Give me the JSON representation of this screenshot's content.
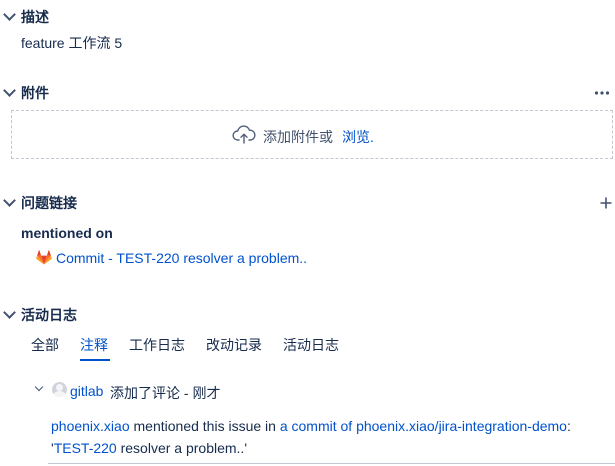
{
  "description": {
    "title": "描述",
    "body": "feature 工作流 5"
  },
  "attachments": {
    "title": "附件",
    "more_icon": "ellipsis-icon",
    "drop_text": "添加附件或",
    "browse_link": "浏览."
  },
  "issue_links": {
    "title": "问题链接",
    "add_icon": "plus-icon",
    "relation": "mentioned on",
    "items": [
      {
        "icon": "gitlab-icon",
        "text": "Commit - TEST-220 resolver a problem.."
      }
    ]
  },
  "activity": {
    "title": "活动日志",
    "tabs": [
      {
        "label": "全部",
        "active": false
      },
      {
        "label": "注释",
        "active": true
      },
      {
        "label": "工作日志",
        "active": false
      },
      {
        "label": "改动记录",
        "active": false
      },
      {
        "label": "活动日志",
        "active": false
      }
    ],
    "comment": {
      "author": "gitlab",
      "action": "添加了评论 - 刚才",
      "mention_user": "phoenix.xiao",
      "mention_text": " mentioned this issue in ",
      "commit_link": "a commit of phoenix.xiao/jira-integration-demo",
      "colon": ":",
      "quote_open": "'",
      "issue_key": "TEST-220",
      "quote_rest": " resolver a problem..'"
    }
  },
  "colors": {
    "link": "#0052cc",
    "text": "#172b4d",
    "gitlab_orange": "#e24329"
  }
}
